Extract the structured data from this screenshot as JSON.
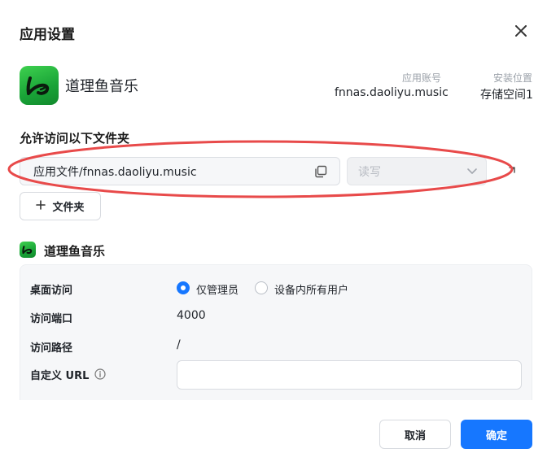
{
  "dialog": {
    "title": "应用设置",
    "close_icon": "close-icon"
  },
  "app": {
    "name": "道理鱼音乐",
    "icon": "app-logo-icon",
    "account_label": "应用账号",
    "account_value": "fnnas.daoliyu.music",
    "location_label": "安装位置",
    "location_value": "存储空间1"
  },
  "folders": {
    "section_title": "允许访问以下文件夹",
    "path_value": "应用文件/fnnas.daoliyu.music",
    "permission_placeholder": "读写",
    "add_folder_label": "文件夹",
    "add_icon": "plus-icon"
  },
  "service": {
    "title": "道理鱼音乐",
    "desktop_access_label": "桌面访问",
    "options": [
      "仅管理员",
      "设备内所有用户"
    ],
    "selected_option": "仅管理员",
    "port_label": "访问端口",
    "port_value": "4000",
    "path_label": "访问路径",
    "path_value": "/",
    "custom_url_label": "自定义 URL",
    "custom_url_value": ""
  },
  "footer": {
    "cancel_label": "取消",
    "confirm_label": "确定"
  },
  "colors": {
    "accent": "#1677ff",
    "app_green": "#19a337",
    "highlight_red": "#e84a4a"
  }
}
